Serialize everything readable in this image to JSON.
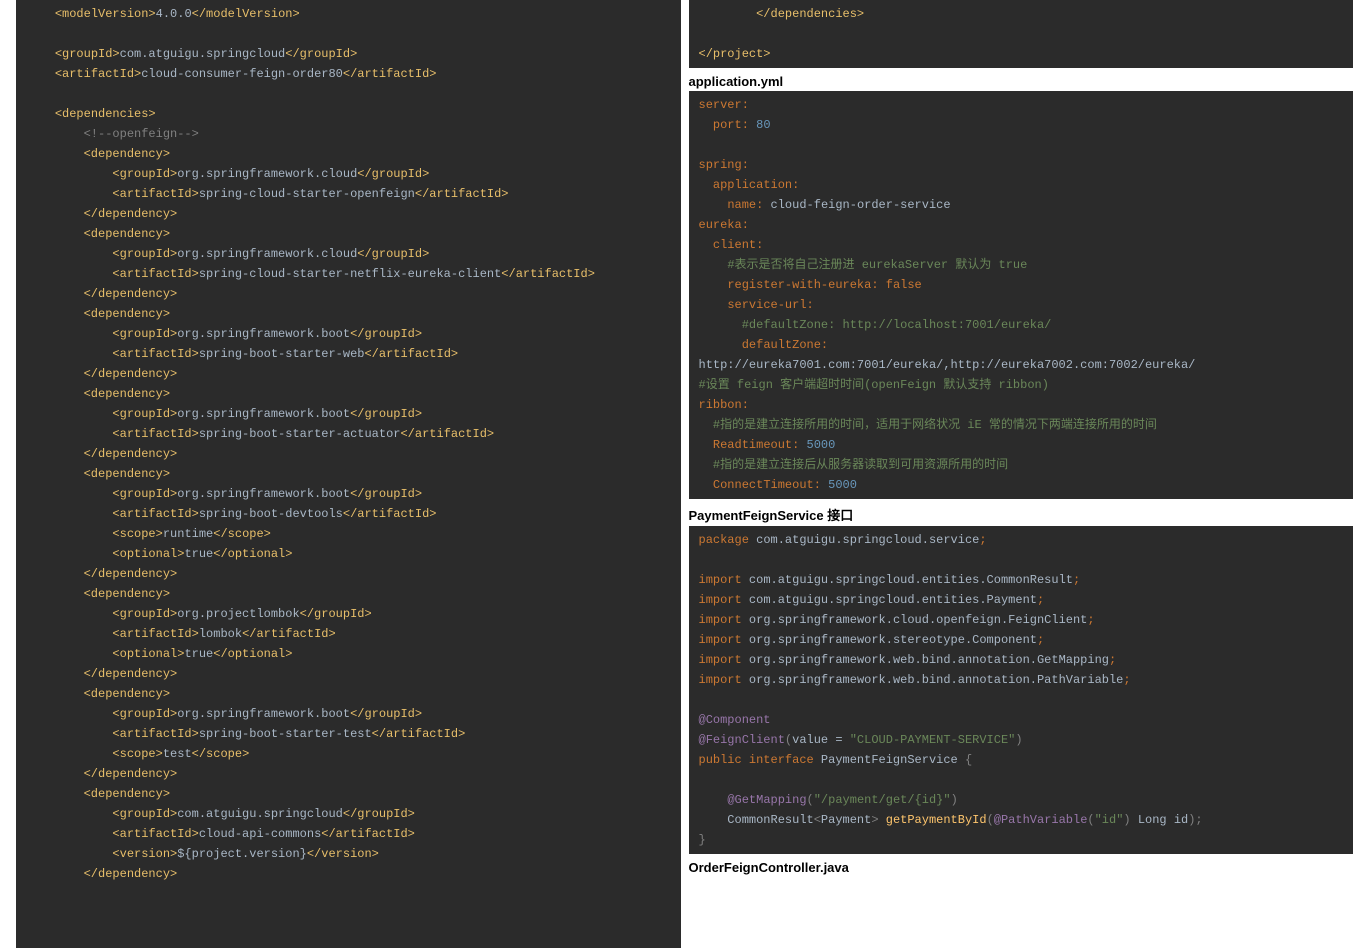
{
  "left": {
    "lines": [
      "    <t>&lt;modelVersion&gt;</t>4.0.0<t>&lt;/modelVersion&gt;</t>",
      "",
      "    <t>&lt;groupId&gt;</t>com.atguigu.springcloud<t>&lt;/groupId&gt;</t>",
      "    <t>&lt;artifactId&gt;</t>cloud-consumer-feign-order80<t>&lt;/artifactId&gt;</t>",
      "",
      "    <t>&lt;dependencies&gt;</t>",
      "        <c>&lt;!--openfeign--&gt;</c>",
      "        <t>&lt;dependency&gt;</t>",
      "            <t>&lt;groupId&gt;</t>org.springframework.cloud<t>&lt;/groupId&gt;</t>",
      "            <t>&lt;artifactId&gt;</t>spring-cloud-starter-openfeign<t>&lt;/artifactId&gt;</t>",
      "        <t>&lt;/dependency&gt;</t>",
      "        <t>&lt;dependency&gt;</t>",
      "            <t>&lt;groupId&gt;</t>org.springframework.cloud<t>&lt;/groupId&gt;</t>",
      "            <t>&lt;artifactId&gt;</t>spring-cloud-starter-netflix-eureka-client<t>&lt;/artifactId&gt;</t>",
      "        <t>&lt;/dependency&gt;</t>",
      "        <t>&lt;dependency&gt;</t>",
      "            <t>&lt;groupId&gt;</t>org.springframework.boot<t>&lt;/groupId&gt;</t>",
      "            <t>&lt;artifactId&gt;</t>spring-boot-starter-web<t>&lt;/artifactId&gt;</t>",
      "        <t>&lt;/dependency&gt;</t>",
      "        <t>&lt;dependency&gt;</t>",
      "            <t>&lt;groupId&gt;</t>org.springframework.boot<t>&lt;/groupId&gt;</t>",
      "            <t>&lt;artifactId&gt;</t>spring-boot-starter-actuator<t>&lt;/artifactId&gt;</t>",
      "        <t>&lt;/dependency&gt;</t>",
      "        <t>&lt;dependency&gt;</t>",
      "            <t>&lt;groupId&gt;</t>org.springframework.boot<t>&lt;/groupId&gt;</t>",
      "            <t>&lt;artifactId&gt;</t>spring-boot-devtools<t>&lt;/artifactId&gt;</t>",
      "            <t>&lt;scope&gt;</t>runtime<t>&lt;/scope&gt;</t>",
      "            <t>&lt;optional&gt;</t>true<t>&lt;/optional&gt;</t>",
      "        <t>&lt;/dependency&gt;</t>",
      "        <t>&lt;dependency&gt;</t>",
      "            <t>&lt;groupId&gt;</t>org.projectlombok<t>&lt;/groupId&gt;</t>",
      "            <t>&lt;artifactId&gt;</t>lombok<t>&lt;/artifactId&gt;</t>",
      "            <t>&lt;optional&gt;</t>true<t>&lt;/optional&gt;</t>",
      "        <t>&lt;/dependency&gt;</t>",
      "        <t>&lt;dependency&gt;</t>",
      "            <t>&lt;groupId&gt;</t>org.springframework.boot<t>&lt;/groupId&gt;</t>",
      "            <t>&lt;artifactId&gt;</t>spring-boot-starter-test<t>&lt;/artifactId&gt;</t>",
      "            <t>&lt;scope&gt;</t>test<t>&lt;/scope&gt;</t>",
      "        <t>&lt;/dependency&gt;</t>",
      "        <t>&lt;dependency&gt;</t>",
      "            <t>&lt;groupId&gt;</t>com.atguigu.springcloud<t>&lt;/groupId&gt;</t>",
      "            <t>&lt;artifactId&gt;</t>cloud-api-commons<t>&lt;/artifactId&gt;</t>",
      "            <t>&lt;version&gt;</t>${project.version}<t>&lt;/version&gt;</t>",
      "        <t>&lt;/dependency&gt;</t>"
    ]
  },
  "right": {
    "block1": [
      "        <t>&lt;/dependencies&gt;</t>",
      "",
      "<t>&lt;/project&gt;</t>"
    ],
    "heading1": "application.yml",
    "block2": [
      "<k>server:</k>",
      "  <k>port:</k> <b>80</b>",
      "",
      "<k>spring:</k>",
      "  <k>application:</k>",
      "    <k>name:</k> cloud-feign-order-service",
      "<k>eureka:</k>",
      "  <k>client:</k>",
      "    <s>#表示是否将自己注册进 eurekaServer 默认为 true</s>",
      "    <k>register-with-eureka: false</k>",
      "    <k>service-url:</k>",
      "      <s>#defaultZone: http://localhost:7001/eureka/</s>",
      "      <k>defaultZone:</k>",
      "http://eureka7001.com:7001/eureka/,http://eureka7002.com:7002/eureka/",
      "<s>#设置 feign 客户端超时时间(openFeign 默认支持 ribbon)</s>",
      "<k>ribbon:</k>",
      "  <s>#指的是建立连接所用的时间，适用于网络状况 iE 常的情况下两端连接所用的时间</s>",
      "  <k>Readtimeout:</k> <b>5000</b>",
      "  <s>#指的是建立连接后从服务器读取到可用资源所用的时间</s>",
      "  <k>ConnectTimeout:</k> <b>5000</b>"
    ],
    "heading2": "PaymentFeignService 接口",
    "block3": [
      "<k>package</k> com.atguigu.springcloud.service<k>;</k>",
      "",
      "<k>import</k> com.atguigu.springcloud.entities.CommonResult<k>;</k>",
      "<k>import</k> com.atguigu.springcloud.entities.Payment<k>;</k>",
      "<k>import</k> org.springframework.cloud.openfeign.FeignClient<k>;</k>",
      "<k>import</k> org.springframework.stereotype.Component<k>;</k>",
      "<k>import</k> org.springframework.web.bind.annotation.GetMapping<k>;</k>",
      "<k>import</k> org.springframework.web.bind.annotation.PathVariable<k>;</k>",
      "",
      "<n>@Component</n>",
      "<n>@FeignClient</n><c>(</c>value = <s>\"CLOUD-PAYMENT-SERVICE\"</s><c>)</c>",
      "<k>public interface</k> PaymentFeignService <c>{</c>",
      "",
      "    <n>@GetMapping</n><c>(</c><s>\"/payment/get/{id}\"</s><c>)</c>",
      "    CommonResult<c>&lt;</c>Payment<c>&gt;</c> <f>getPaymentById</f><c>(</c><n>@PathVariable</n><c>(</c><s>\"id\"</s><c>)</c> Long id<c>);</c>",
      "<c>}</c>"
    ],
    "heading3": "OrderFeignController.java"
  }
}
